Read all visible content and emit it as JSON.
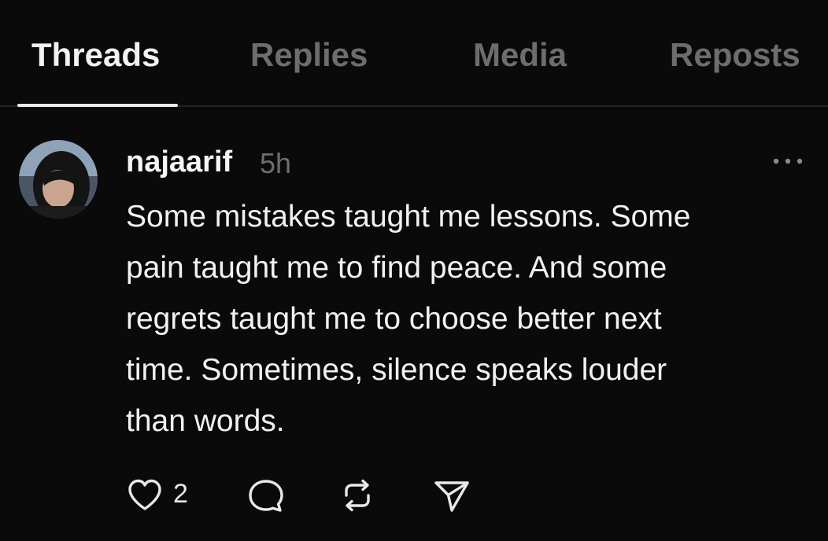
{
  "tabs": [
    {
      "label": "Threads",
      "active": true
    },
    {
      "label": "Replies",
      "active": false
    },
    {
      "label": "Media",
      "active": false
    },
    {
      "label": "Reposts",
      "active": false
    }
  ],
  "post": {
    "username": "najaarif",
    "time": "5h",
    "text_lines": [
      "Some mistakes taught me lessons. Some",
      "pain taught me to find peace. And some",
      "regrets taught me to choose better next",
      "time. Sometimes, silence speaks louder",
      "than words."
    ],
    "likes": "2"
  },
  "icons": {
    "more": "more-horizontal-icon",
    "like": "heart-icon",
    "reply": "comment-icon",
    "repost": "repost-icon",
    "share": "send-icon"
  },
  "colors": {
    "background": "#0a0a0a",
    "text_primary": "#f2f2f2",
    "text_muted": "#6d6d6d"
  }
}
